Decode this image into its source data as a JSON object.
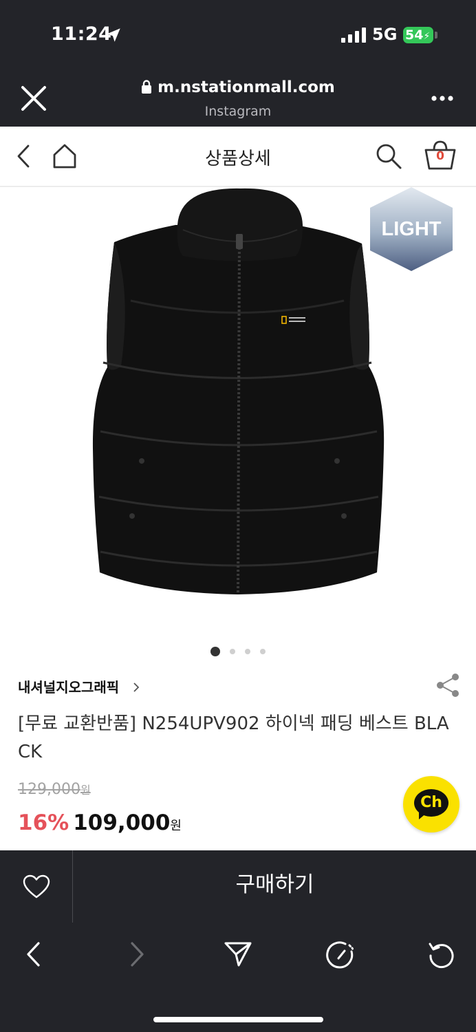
{
  "status_bar": {
    "time": "11:24",
    "network": "5G",
    "battery": "54",
    "location_icon": "location-arrow-icon",
    "signal_icon": "cellular-signal-icon"
  },
  "browser": {
    "url": "m.nstationmall.com",
    "source": "Instagram",
    "close_icon": "close-icon",
    "more_icon": "more-dots-icon"
  },
  "app_header": {
    "title": "상품상세",
    "cart_count": "0"
  },
  "product": {
    "badge": "LIGHT",
    "image_count": 4,
    "active_image": 1,
    "brand": "내셔널지오그래픽",
    "name": "[무료 교환반품] N254UPV902 하이넥 패딩 베스트 BLACK",
    "original_price": "129,000",
    "original_price_unit": "원",
    "discount": "16%",
    "sale_price": "109,000",
    "sale_price_unit": "원"
  },
  "chat": {
    "label": "Ch"
  },
  "buy_bar": {
    "buy_label": "구매하기"
  },
  "colors": {
    "dark_bar": "#232429",
    "discount": "#e5525a",
    "chat_yellow": "#fae100",
    "cart_accent": "#e04a3a"
  }
}
